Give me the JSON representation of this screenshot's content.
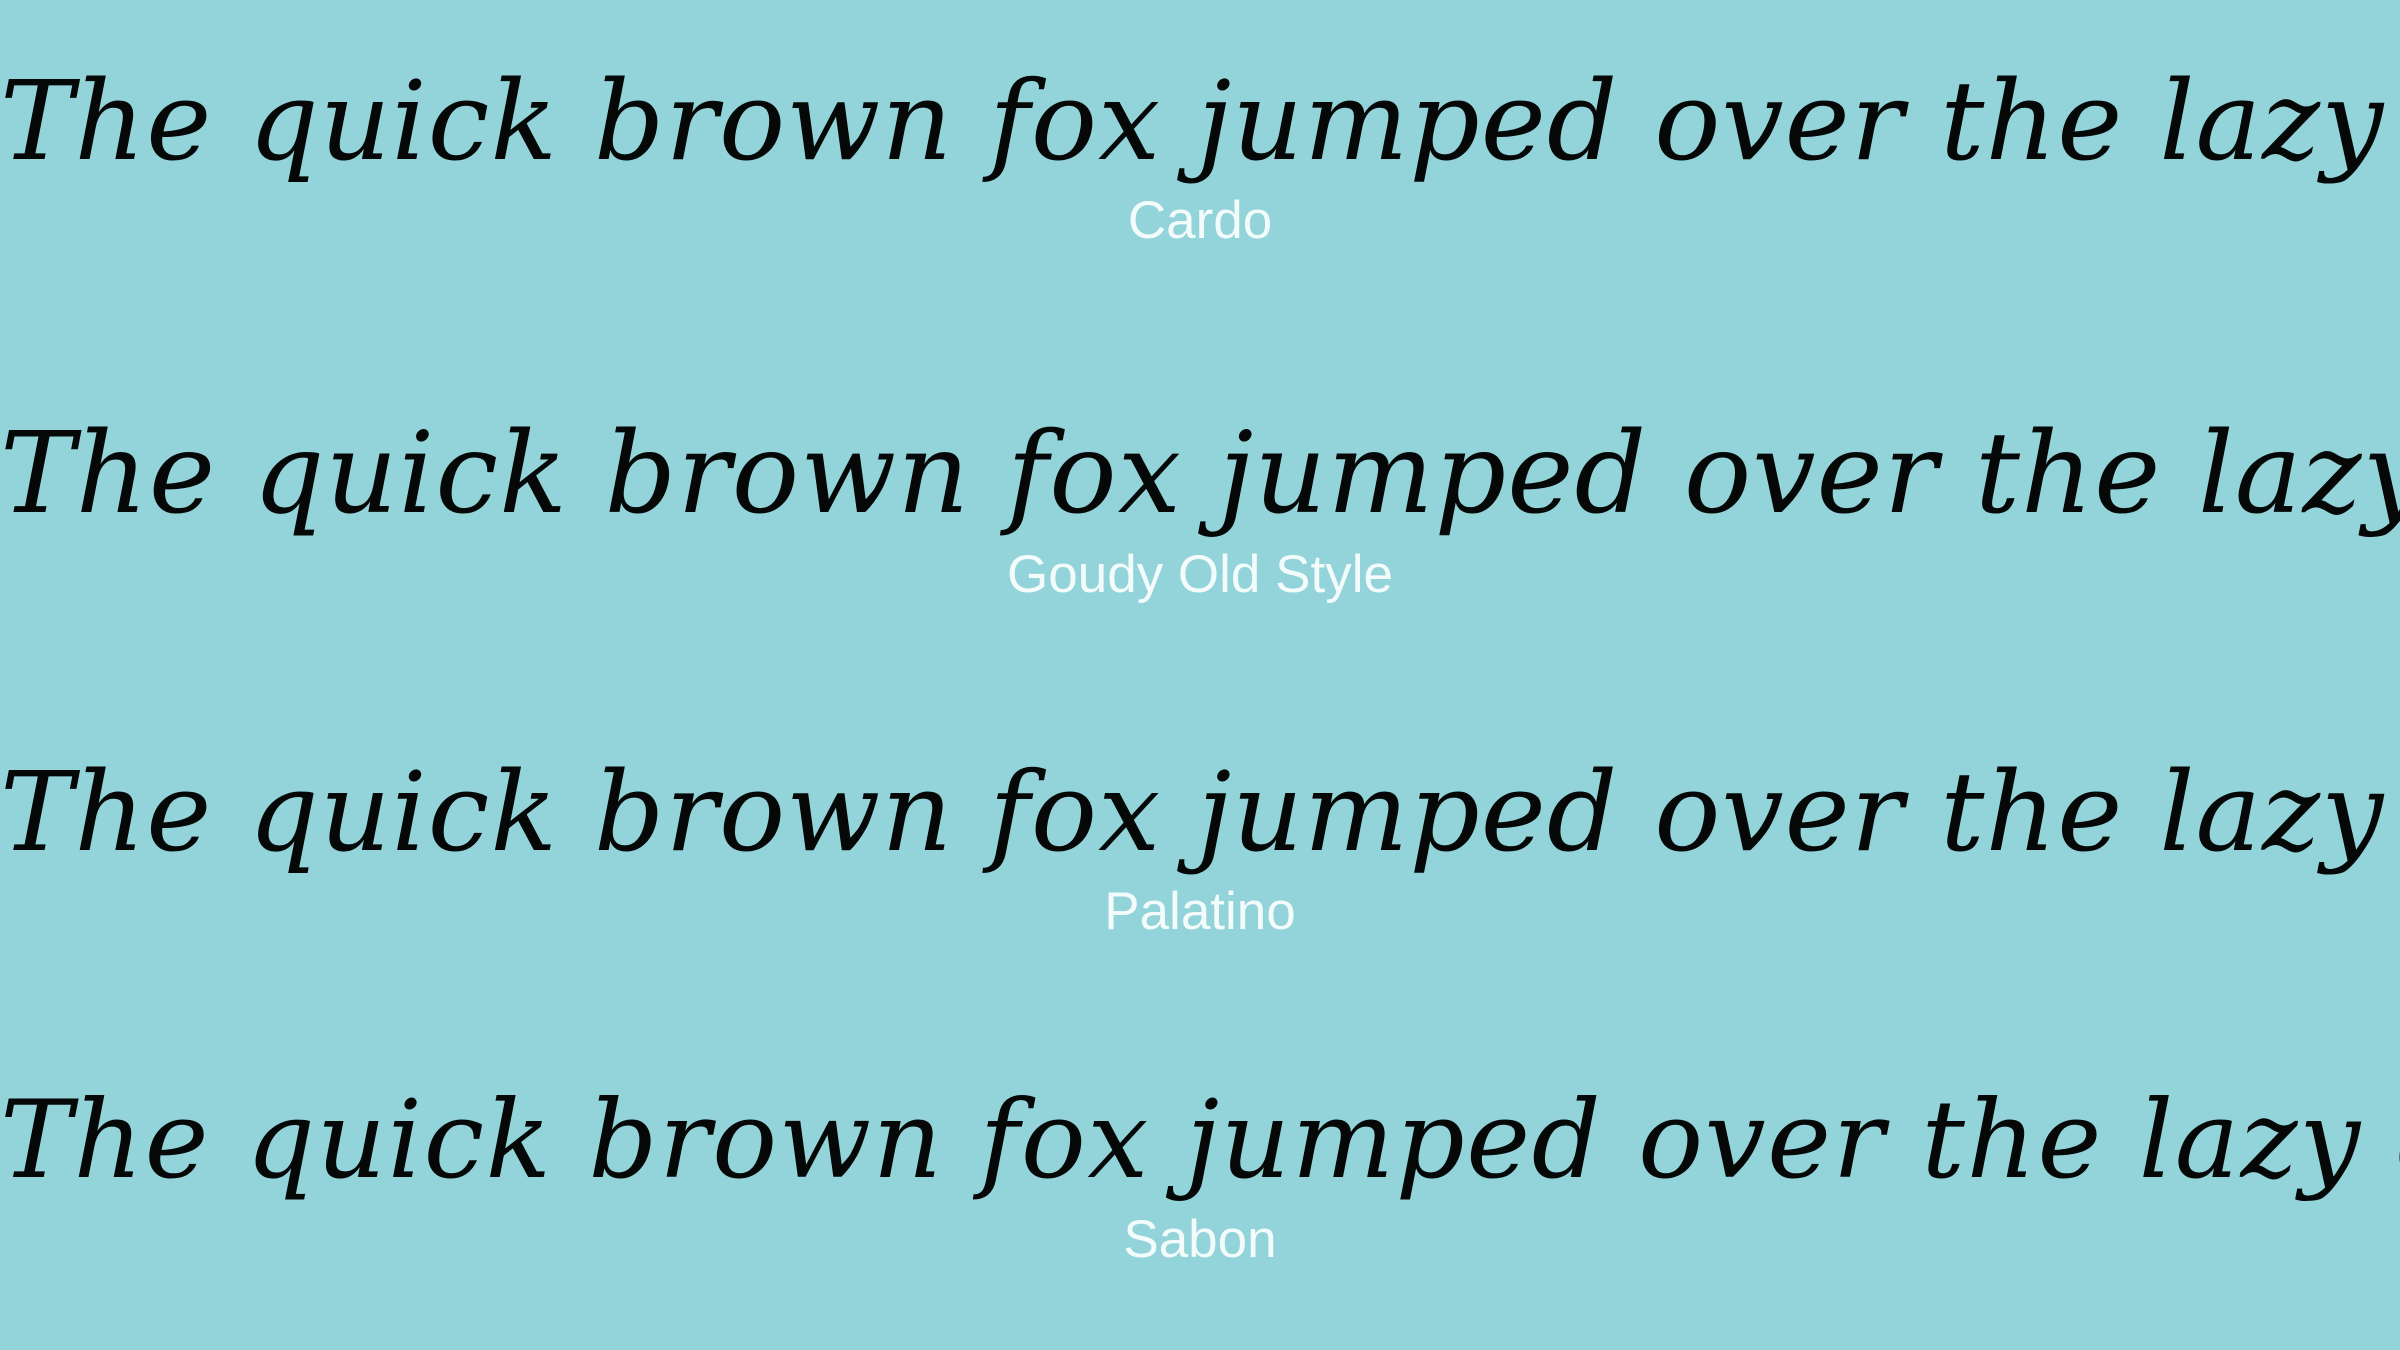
{
  "specimens": [
    {
      "sample_text": "The quick brown fox jumped over the lazy dog.",
      "font_name": "Cardo"
    },
    {
      "sample_text": "The quick brown fox jumped over the lazy dog.",
      "font_name": "Goudy Old Style"
    },
    {
      "sample_text": "The quick brown fox jumped over the lazy dog.",
      "font_name": "Palatino"
    },
    {
      "sample_text": "The quick brown fox jumped over the lazy dog.",
      "font_name": "Sabon"
    }
  ],
  "colors": {
    "background": "#92d4d9",
    "sample_text": "#050807",
    "font_name_text": "#f3fbfb"
  }
}
